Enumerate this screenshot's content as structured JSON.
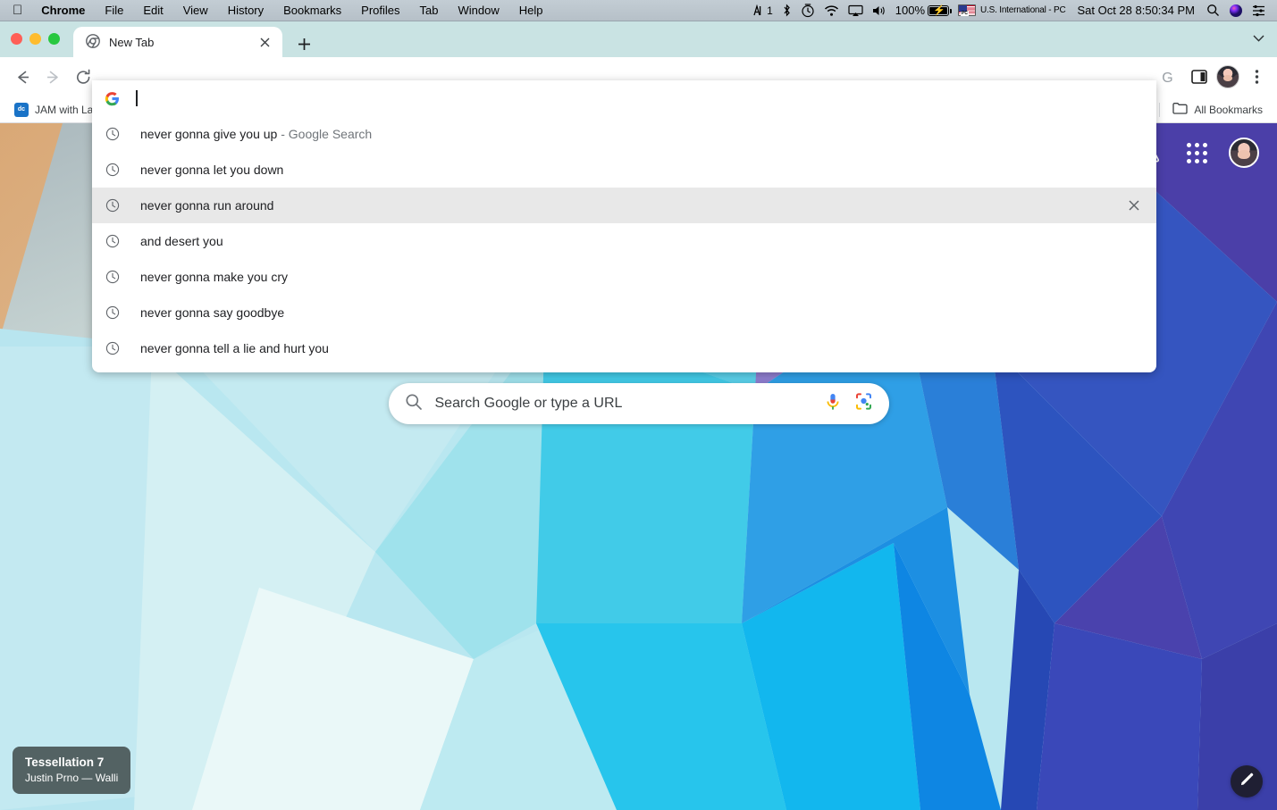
{
  "menubar": {
    "apple_icon": "apple-logo",
    "items": [
      "Chrome",
      "File",
      "Edit",
      "View",
      "History",
      "Bookmarks",
      "Profiles",
      "Tab",
      "Window",
      "Help"
    ],
    "status": {
      "stats_icon": "activity-monitor-icon",
      "stats_value": "1",
      "bluetooth_icon": "bluetooth-icon",
      "timemachine_icon": "time-machine-icon",
      "wifi_icon": "wifi-icon",
      "screen_mirror_icon": "airplay-icon",
      "volume_icon": "volume-icon",
      "battery_percent": "100%",
      "battery_icon": "battery-charging-icon",
      "keyboard_flag_icon": "us-flag-icon",
      "keyboard_layout": "U.S. International - PC",
      "clock": "Sat Oct 28  8:50:34 PM",
      "spotlight_icon": "search-icon",
      "siri_icon": "siri-icon",
      "control_center_icon": "control-center-icon"
    }
  },
  "window": {
    "traffic_lights": [
      "close",
      "minimize",
      "zoom"
    ],
    "tab": {
      "favicon": "chrome-icon",
      "title": "New Tab",
      "close_icon": "close-icon"
    },
    "new_tab_icon": "plus-icon",
    "window_menu_icon": "chevron-down-icon"
  },
  "toolbar": {
    "back_icon": "arrow-left-icon",
    "forward_icon": "arrow-right-icon",
    "reload_icon": "reload-icon",
    "right_icons": [
      "google-icon",
      "side-panel-icon",
      "profile-avatar",
      "three-dot-menu-icon"
    ]
  },
  "bookmarks_bar": {
    "items": [
      {
        "icon": "dc-icon",
        "icon_text": "dc",
        "label": "JAM with La"
      }
    ],
    "all_bookmarks": {
      "folder_icon": "folder-icon",
      "label": "All Bookmarks"
    }
  },
  "omnibox": {
    "favicon": "google-g-icon",
    "value": "",
    "cursor_visible": true,
    "suggestions": [
      {
        "icon": "clock-icon",
        "text": "never gonna give you up",
        "description": " - Google Search",
        "selected": false,
        "removable": false
      },
      {
        "icon": "clock-icon",
        "text": "never gonna let you down",
        "description": "",
        "selected": false,
        "removable": false
      },
      {
        "icon": "clock-icon",
        "text": "never gonna run around",
        "description": "",
        "selected": true,
        "removable": true,
        "remove_icon": "close-icon"
      },
      {
        "icon": "clock-icon",
        "text": "and desert you",
        "description": "",
        "selected": false,
        "removable": false
      },
      {
        "icon": "clock-icon",
        "text": "never gonna make you cry",
        "description": "",
        "selected": false,
        "removable": false
      },
      {
        "icon": "clock-icon",
        "text": "never gonna say goodbye",
        "description": "",
        "selected": false,
        "removable": false
      },
      {
        "icon": "clock-icon",
        "text": "never gonna tell a lie and hurt you",
        "description": "",
        "selected": false,
        "removable": false
      }
    ]
  },
  "newtab": {
    "top_right_icons": [
      {
        "name": "labs-flask-icon"
      },
      {
        "name": "google-apps-grid-icon"
      },
      {
        "name": "account-avatar"
      }
    ],
    "searchbox": {
      "search_icon": "search-icon",
      "placeholder": "Search Google or type a URL",
      "mic_icon": "microphone-icon",
      "lens_icon": "google-lens-icon"
    },
    "attribution": {
      "title": "Tessellation 7",
      "subtitle": "Justin Prno — Walli"
    },
    "customize_button": {
      "icon": "pencil-icon"
    }
  },
  "colors": {
    "tabstrip": "#c9e3e3",
    "selected_suggestion": "#e8e8e8",
    "fab": "#1f1f33",
    "attribution_bg": "rgba(64,74,74,.85)",
    "google_blue": "#4285f4",
    "google_red": "#ea4335",
    "google_yellow": "#fbbc05",
    "google_green": "#34a853"
  }
}
